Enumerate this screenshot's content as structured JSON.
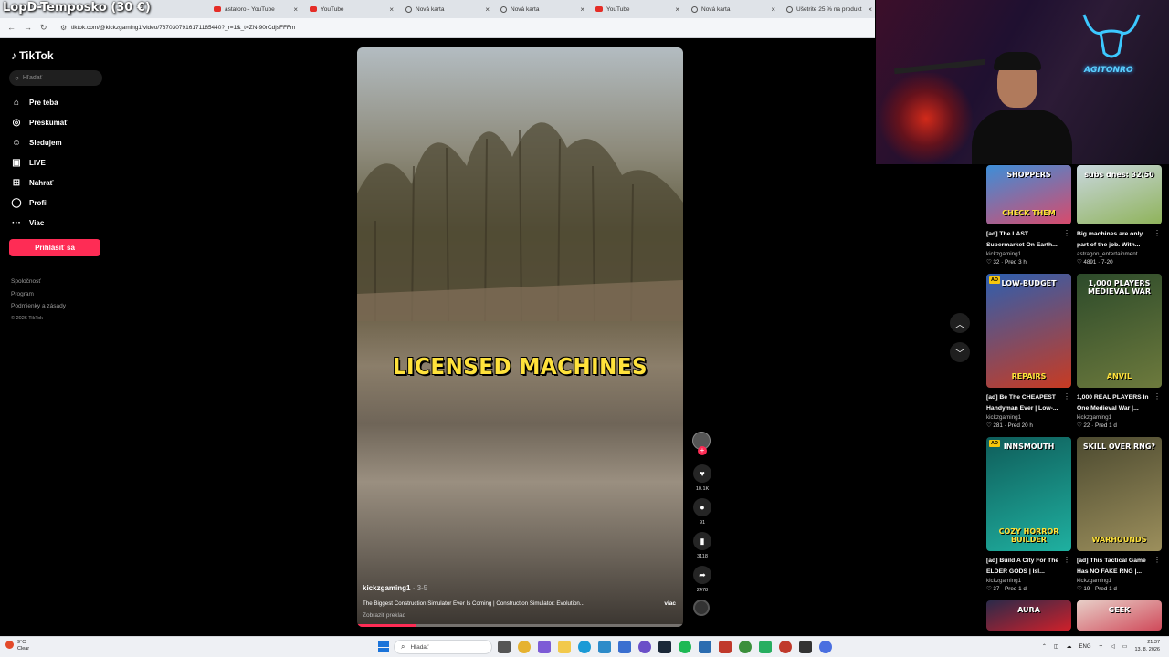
{
  "stream_overlay": {
    "title": "LopD-Temposko (30 €)"
  },
  "browser": {
    "tabs": [
      {
        "label": "astatoro - YouTube",
        "icon": "youtube-icon"
      },
      {
        "label": "YouTube",
        "icon": "youtube-icon"
      },
      {
        "label": "Nová karta",
        "icon": "globe-icon"
      },
      {
        "label": "Nová karta",
        "icon": "globe-icon"
      },
      {
        "label": "YouTube",
        "icon": "youtube-icon"
      },
      {
        "label": "Nová karta",
        "icon": "globe-icon"
      },
      {
        "label": "Ušetrite 25 % na produkt",
        "icon": "steam-icon"
      }
    ],
    "url": "tiktok.com/@kickzgaming1/video/7670307916171185440?_r=1&_t=ZN-90rCdjsFFFm"
  },
  "sidebar": {
    "logo": "TikTok",
    "search_placeholder": "Hľadať",
    "items": [
      {
        "label": "Pre teba",
        "icon": "home-icon"
      },
      {
        "label": "Preskúmať",
        "icon": "compass-icon"
      },
      {
        "label": "Sledujem",
        "icon": "following-icon"
      },
      {
        "label": "LIVE",
        "icon": "live-icon"
      },
      {
        "label": "Nahrať",
        "icon": "upload-icon"
      },
      {
        "label": "Profil",
        "icon": "profile-icon"
      },
      {
        "label": "Viac",
        "icon": "more-icon"
      }
    ],
    "login_label": "Prihlásiť sa",
    "footer": [
      "Spoločnosť",
      "Program",
      "Podmienky a zásady"
    ],
    "copyright": "© 2026 TikTok"
  },
  "video": {
    "caption": "LICENSED MACHINES",
    "author": "kickzgaming1",
    "author_suffix": "· 3-5",
    "description": "The Biggest Construction Simulator Ever Is Coming | Construction Simulator: Evolution...",
    "more_label": "viac",
    "translate_label": "Zobraziť preklad",
    "progress": 0.18
  },
  "actions": {
    "likes": "10.1K",
    "comments": "91",
    "saves": "3118",
    "shares": "2478"
  },
  "webcam": {
    "sign_text": "AGITONRO"
  },
  "suggested": [
    {
      "thumb_text": "SHOPPERS",
      "thumb_text2": "CHECK THEM",
      "ad": false,
      "title": "[ad] The LAST Supermarket On Earth...",
      "author": "kickzgaming1",
      "likes": "32",
      "when": "Pred 3 h",
      "colors": [
        "#3d8ed8",
        "#d94a6b"
      ]
    },
    {
      "thumb_text": "subs dnes: 32/50",
      "thumb_text2": "",
      "ad": false,
      "title": "Big machines are only part of the job. With...",
      "author": "astragon_entertainment",
      "likes": "4891",
      "when": "7-20",
      "colors": [
        "#c9d7de",
        "#8fb35a"
      ]
    },
    {
      "thumb_text": "LOW-BUDGET",
      "thumb_text2": "REPAIRS",
      "ad": true,
      "title": "[ad] Be The CHEAPEST Handyman Ever | Low-...",
      "author": "kickzgaming1",
      "likes": "281",
      "when": "Pred 20 h",
      "colors": [
        "#2d5fb0",
        "#c83b22"
      ]
    },
    {
      "thumb_text": "1,000 PLAYERS MEDIEVAL WAR",
      "thumb_text2": "ANVIL",
      "ad": false,
      "title": "1,000 REAL PLAYERS In One Medieval War |...",
      "author": "kickzgaming1",
      "likes": "22",
      "when": "Pred 1 d",
      "colors": [
        "#2c4a2a",
        "#6d7a3d"
      ]
    },
    {
      "thumb_text": "INNSMOUTH",
      "thumb_text2": "COZY HORROR BUILDER",
      "ad": true,
      "title": "[ad] Build A City For The ELDER GODS | Isl...",
      "author": "kickzgaming1",
      "likes": "37",
      "when": "Pred 1 d",
      "colors": [
        "#0f5d5a",
        "#1fb0a0"
      ]
    },
    {
      "thumb_text": "SKILL OVER RNG?",
      "thumb_text2": "WARHOUNDS",
      "ad": false,
      "title": "[ad] This Tactical Game Has NO FAKE RNG |...",
      "author": "kickzgaming1",
      "likes": "19",
      "when": "Pred 1 d",
      "colors": [
        "#4c4a30",
        "#9c8f5c"
      ]
    },
    {
      "thumb_text": "AURA",
      "thumb_text2": "",
      "ad": false,
      "title": "",
      "author": "",
      "likes": "",
      "when": "",
      "colors": [
        "#2a2a4a",
        "#d0202a"
      ]
    },
    {
      "thumb_text": "GEEK",
      "thumb_text2": "",
      "ad": false,
      "title": "",
      "author": "",
      "likes": "",
      "when": "",
      "colors": [
        "#e8cfc8",
        "#d04a5a"
      ]
    }
  ],
  "taskbar": {
    "weather_temp": "9°C",
    "weather_desc": "Clear",
    "search_placeholder": "Hľadať",
    "lang": "ENG",
    "time": "21:37",
    "date": "13. 8. 2026"
  }
}
